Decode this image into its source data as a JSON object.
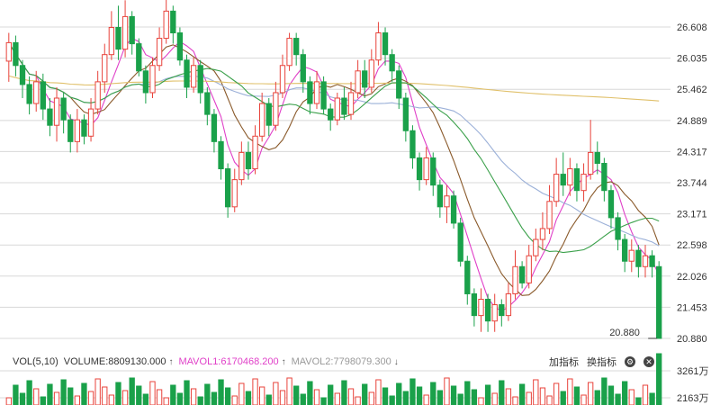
{
  "chart_data": {
    "type": "candlestick",
    "y_ticks": [
      "26.608",
      "26.035",
      "25.462",
      "24.889",
      "24.317",
      "23.744",
      "23.171",
      "22.598",
      "22.026",
      "21.453",
      "20.880"
    ],
    "ylim": [
      20.88,
      26.608
    ],
    "annotations": {
      "high": "27.181",
      "low": "20.880"
    },
    "up_color": "#e8433b",
    "down_color": "#1aa14a",
    "ma_colors": [
      "#e040c8",
      "#8a5a2b",
      "#9bb0d8",
      "#e0c06a",
      "#3aa04a"
    ],
    "candles": [
      [
        25.98,
        26.32,
        25.6,
        26.5
      ],
      [
        26.32,
        25.9,
        25.7,
        26.45
      ],
      [
        25.9,
        25.55,
        25.3,
        26.0
      ],
      [
        25.55,
        25.2,
        25.0,
        25.7
      ],
      [
        25.2,
        25.6,
        25.05,
        25.8
      ],
      [
        25.6,
        25.1,
        24.9,
        25.75
      ],
      [
        25.1,
        24.8,
        24.6,
        25.3
      ],
      [
        24.8,
        25.3,
        24.5,
        25.5
      ],
      [
        25.3,
        24.9,
        24.65,
        25.4
      ],
      [
        24.9,
        24.5,
        24.3,
        25.0
      ],
      [
        24.5,
        24.9,
        24.3,
        25.1
      ],
      [
        24.9,
        24.6,
        24.45,
        25.0
      ],
      [
        24.6,
        25.1,
        24.5,
        25.3
      ],
      [
        25.1,
        25.6,
        25.0,
        25.8
      ],
      [
        25.6,
        26.1,
        25.4,
        26.3
      ],
      [
        26.1,
        26.6,
        26.0,
        26.9
      ],
      [
        26.6,
        26.2,
        26.0,
        27.0
      ],
      [
        26.2,
        26.8,
        26.05,
        27.1
      ],
      [
        26.8,
        26.3,
        26.1,
        26.9
      ],
      [
        26.3,
        25.8,
        25.7,
        26.4
      ],
      [
        25.8,
        25.4,
        25.2,
        25.9
      ],
      [
        25.4,
        25.9,
        25.3,
        26.05
      ],
      [
        25.9,
        26.4,
        25.8,
        26.6
      ],
      [
        26.4,
        26.9,
        26.3,
        27.181
      ],
      [
        26.9,
        26.5,
        26.3,
        27.0
      ],
      [
        26.5,
        26.0,
        25.9,
        26.6
      ],
      [
        26.0,
        25.5,
        25.3,
        26.1
      ],
      [
        25.5,
        25.9,
        25.4,
        26.05
      ],
      [
        25.9,
        25.4,
        25.2,
        26.0
      ],
      [
        25.4,
        25.0,
        24.8,
        25.5
      ],
      [
        25.0,
        24.5,
        24.3,
        25.1
      ],
      [
        24.5,
        24.0,
        23.8,
        24.6
      ],
      [
        24.0,
        23.3,
        23.1,
        24.1
      ],
      [
        23.3,
        23.8,
        23.2,
        24.0
      ],
      [
        23.8,
        24.3,
        23.7,
        24.5
      ],
      [
        24.3,
        24.0,
        23.8,
        24.5
      ],
      [
        24.0,
        24.6,
        23.9,
        24.8
      ],
      [
        24.6,
        25.2,
        24.5,
        25.4
      ],
      [
        25.2,
        24.8,
        24.6,
        25.3
      ],
      [
        24.8,
        25.4,
        24.7,
        25.6
      ],
      [
        25.4,
        25.9,
        25.3,
        26.1
      ],
      [
        25.9,
        26.4,
        25.8,
        26.5
      ],
      [
        26.4,
        26.1,
        25.9,
        26.5
      ],
      [
        26.1,
        25.6,
        25.4,
        26.2
      ],
      [
        25.6,
        25.2,
        25.0,
        25.7
      ],
      [
        25.2,
        25.6,
        25.1,
        25.8
      ],
      [
        25.6,
        25.1,
        25.0,
        25.7
      ],
      [
        25.1,
        24.9,
        24.7,
        25.2
      ],
      [
        24.9,
        25.3,
        24.8,
        25.4
      ],
      [
        25.3,
        25.0,
        24.9,
        25.5
      ],
      [
        25.0,
        25.4,
        24.9,
        25.6
      ],
      [
        25.4,
        25.8,
        25.3,
        26.0
      ],
      [
        25.8,
        25.5,
        25.3,
        26.0
      ],
      [
        25.5,
        26.0,
        25.4,
        26.2
      ],
      [
        26.0,
        26.5,
        25.9,
        26.7
      ],
      [
        26.5,
        26.1,
        25.9,
        26.6
      ],
      [
        26.1,
        25.8,
        25.6,
        26.2
      ],
      [
        25.8,
        25.3,
        25.1,
        25.9
      ],
      [
        25.3,
        24.7,
        24.5,
        25.4
      ],
      [
        24.7,
        24.2,
        24.0,
        24.8
      ],
      [
        24.2,
        23.8,
        23.6,
        24.3
      ],
      [
        23.8,
        24.2,
        23.7,
        24.4
      ],
      [
        24.2,
        23.7,
        23.5,
        24.3
      ],
      [
        23.7,
        23.3,
        23.1,
        23.8
      ],
      [
        23.3,
        23.5,
        23.0,
        23.7
      ],
      [
        23.5,
        23.0,
        22.9,
        23.6
      ],
      [
        23.0,
        22.3,
        22.2,
        23.1
      ],
      [
        22.3,
        21.7,
        21.5,
        22.4
      ],
      [
        21.7,
        21.3,
        21.1,
        21.8
      ],
      [
        21.3,
        21.6,
        21.0,
        21.8
      ],
      [
        21.6,
        21.2,
        21.0,
        21.7
      ],
      [
        21.2,
        21.5,
        21.0,
        21.7
      ],
      [
        21.5,
        21.3,
        21.1,
        21.6
      ],
      [
        21.3,
        21.7,
        21.2,
        21.9
      ],
      [
        21.7,
        22.2,
        21.6,
        22.5
      ],
      [
        22.2,
        21.9,
        21.8,
        22.3
      ],
      [
        21.9,
        22.4,
        21.8,
        22.6
      ],
      [
        22.4,
        22.7,
        22.3,
        22.9
      ],
      [
        22.7,
        22.9,
        22.5,
        23.2
      ],
      [
        22.9,
        23.4,
        22.8,
        23.7
      ],
      [
        23.4,
        23.9,
        23.3,
        24.2
      ],
      [
        23.9,
        23.7,
        23.5,
        24.3
      ],
      [
        23.7,
        24.0,
        23.5,
        24.2
      ],
      [
        24.0,
        23.6,
        23.4,
        24.1
      ],
      [
        23.6,
        23.9,
        23.4,
        24.1
      ],
      [
        23.9,
        24.3,
        23.8,
        24.9
      ],
      [
        24.3,
        24.1,
        23.9,
        24.5
      ],
      [
        24.1,
        23.6,
        23.4,
        24.2
      ],
      [
        23.6,
        23.1,
        22.9,
        23.7
      ],
      [
        23.1,
        22.7,
        22.5,
        23.2
      ],
      [
        22.7,
        22.3,
        22.1,
        22.8
      ],
      [
        22.3,
        22.5,
        22.1,
        22.7
      ],
      [
        22.5,
        22.2,
        22.0,
        22.6
      ],
      [
        22.2,
        22.4,
        22.0,
        22.6
      ],
      [
        22.4,
        22.2,
        22.0,
        22.5
      ],
      [
        22.2,
        20.88,
        20.88,
        22.3
      ]
    ]
  },
  "volume_legend": {
    "title": "VOL(5,10)",
    "volume": "VOLUME:8809130.000",
    "mavol1": "MAVOL1:6170468.200",
    "mavol2": "MAVOL2:7798079.300",
    "arrow_up": "↑",
    "arrow_down": "↓",
    "btn_add": "加指标",
    "btn_switch": "换指标",
    "vol_ticks": [
      "3261万",
      "2163万"
    ]
  }
}
